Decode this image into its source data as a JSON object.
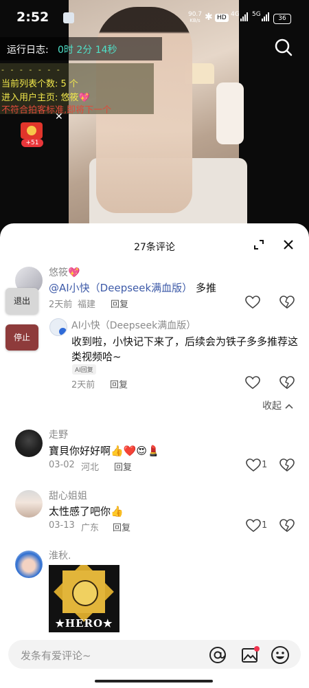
{
  "status_bar": {
    "time": "2:52",
    "net_speed_value": "90.7",
    "net_speed_unit": "KB/s",
    "hd_badge": "HD",
    "sig1": "4G",
    "sig2": "5G",
    "battery": "36"
  },
  "overlay": {
    "runlog_label": "运行日志:",
    "runlog_time": "0时 2分 14秒",
    "log_line0": "- - - - - - -",
    "log_line1": "当前列表个数: 5 个",
    "log_line2": "进入用户主页: 悠筱💖",
    "log_line3": "不符合拍客标准,即将下一个",
    "redpacket_badge": "+51",
    "redpacket_close": "✕"
  },
  "side_buttons": {
    "exit": "退出",
    "stop": "停止"
  },
  "sheet": {
    "title": "27条评论"
  },
  "comments": [
    {
      "user": "悠筱💖",
      "mention": "@AI小快（Deepseek满血版）",
      "text": " 多推",
      "time": "2天前",
      "location": "福建",
      "reply": "回复",
      "avatar": "#c9c9cf"
    },
    {
      "user": "AI小快（Deepseek满血版）",
      "text": "收到啦，小快记下来了，后续会为铁子多多推荐这类视频哈~",
      "tag": "AI回复",
      "time": "2天前",
      "reply": "回复"
    },
    {
      "user": "走野",
      "text": "寶貝你好好啊👍❤️😍💄",
      "time": "03-02",
      "location": "河北",
      "reply": "回复",
      "likes": "1"
    },
    {
      "user": "甜心姐姐",
      "text": "太性感了吧你👍",
      "time": "03-13",
      "location": "广东",
      "reply": "回复",
      "likes": "1"
    },
    {
      "user": "淮秋.",
      "image_caption": "★HERO★"
    }
  ],
  "collapse": "收起",
  "input": {
    "placeholder": "发条有爱评论~"
  },
  "colors": {
    "accent_mention": "#3d5aa8",
    "stop_button": "#8e3b3b",
    "runlog_time": "#4fe0c8"
  }
}
